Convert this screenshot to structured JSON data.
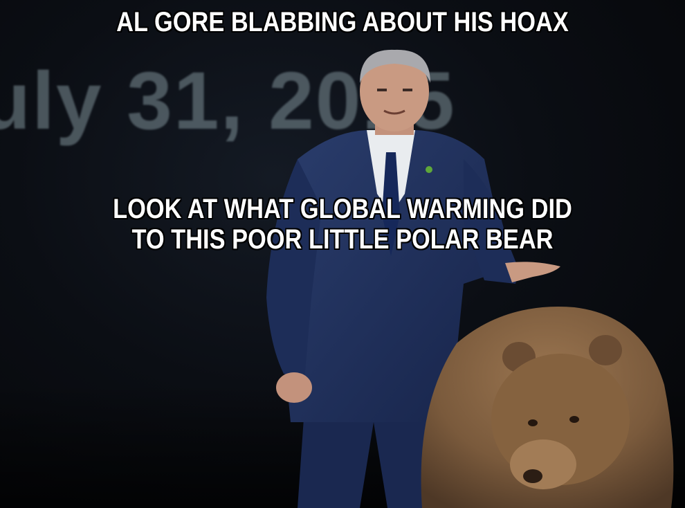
{
  "meme": {
    "top_caption": "AL GORE BLABBING ABOUT HIS HOAX",
    "middle_caption_line1": "LOOK AT WHAT GLOBAL WARMING DID",
    "middle_caption_line2": "TO THIS POOR LITTLE POLAR BEAR"
  },
  "background": {
    "slide_text": "uly 31, 2015"
  },
  "colors": {
    "suit": "#1f2f57",
    "shirt": "#e9ecef",
    "tie": "#16285a",
    "hair": "#a9a9ad",
    "skin": "#c99a82",
    "bear_fur": "#7a5a3c",
    "caption_text": "#ffffff",
    "caption_outline": "#000000"
  }
}
